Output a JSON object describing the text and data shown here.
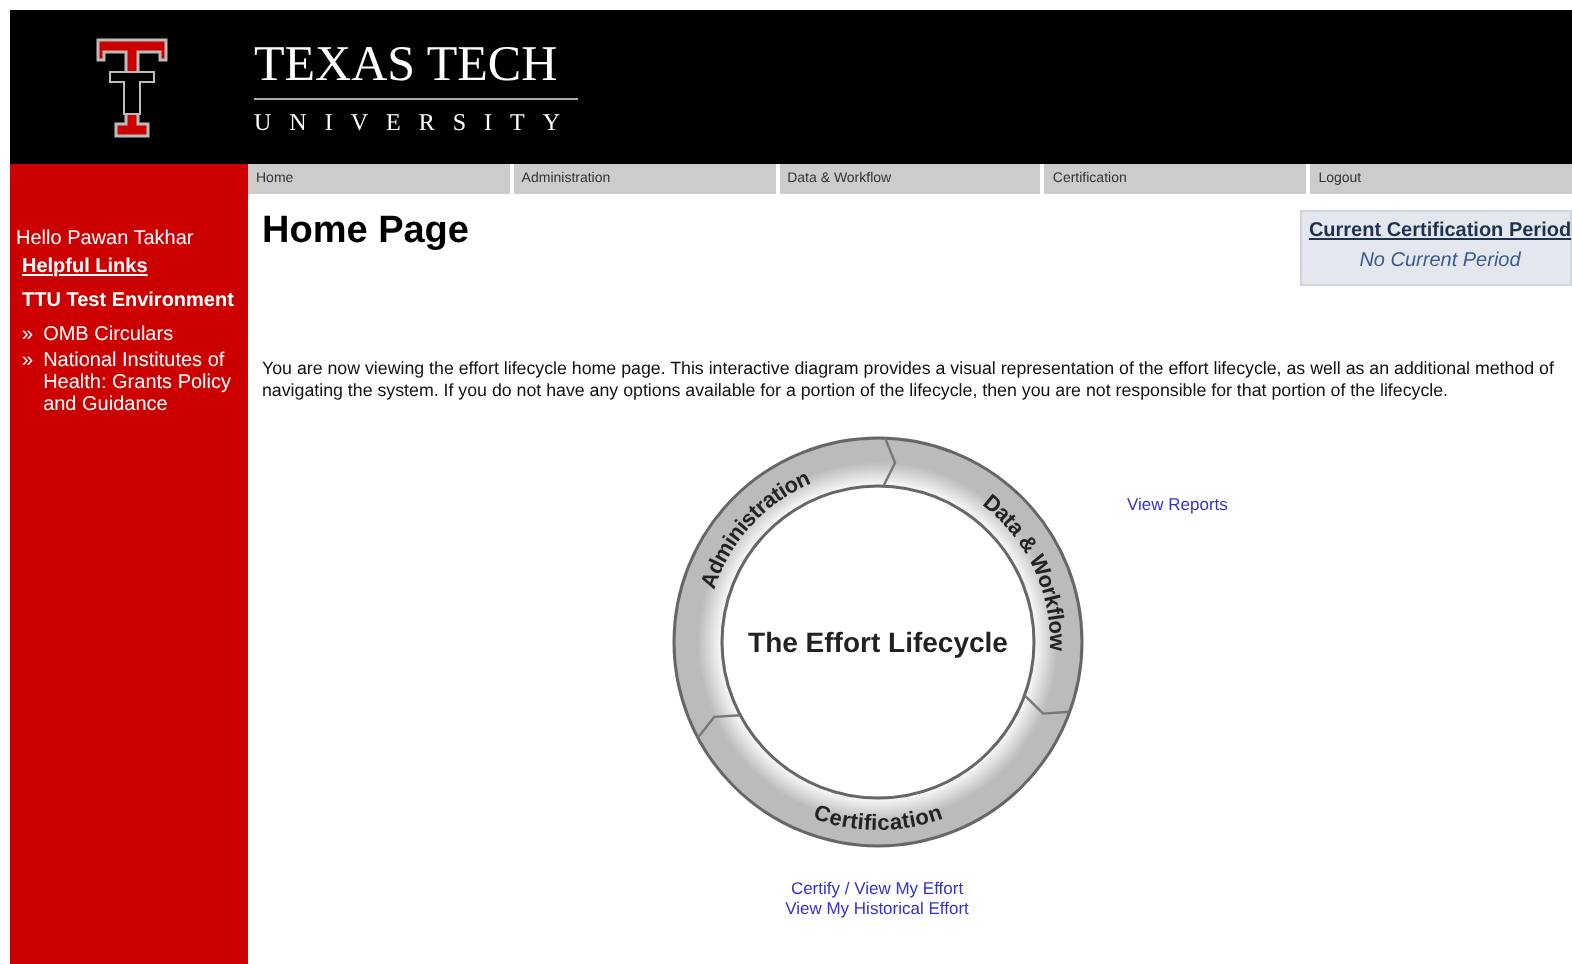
{
  "header": {
    "title": "TEXAS TECH",
    "subtitle": "UNIVERSITY"
  },
  "nav": [
    {
      "label": "Home"
    },
    {
      "label": "Administration"
    },
    {
      "label": "Data & Workflow"
    },
    {
      "label": "Certification"
    },
    {
      "label": "Logout"
    }
  ],
  "sidebar": {
    "greeting": "Hello Pawan Takhar",
    "helpful_links": "Helpful Links",
    "environment": "TTU Test Environment",
    "links": [
      {
        "bullet": "»",
        "label": "OMB Circulars"
      },
      {
        "bullet": "»",
        "label": "National Institutes of Health: Grants Policy and Guidance"
      }
    ]
  },
  "page_title": "Home Page",
  "certification_period": {
    "title": "Current Certification Period",
    "value": "No Current Period"
  },
  "intro": "You are now viewing the effort lifecycle home page. This interactive diagram provides a visual representation of the effort lifecycle, as well as an additional method of navigating the system. If you do not have any options available for a portion of the lifecycle, then you are not responsible for that portion of the lifecycle.",
  "diagram": {
    "center": "The Effort Lifecycle",
    "segments": [
      "Administration",
      "Data & Workflow",
      "Certification"
    ]
  },
  "links": {
    "data_workflow": [
      "View Reports"
    ],
    "certification": [
      "Certify / View My Effort",
      "View My Historical Effort"
    ]
  }
}
